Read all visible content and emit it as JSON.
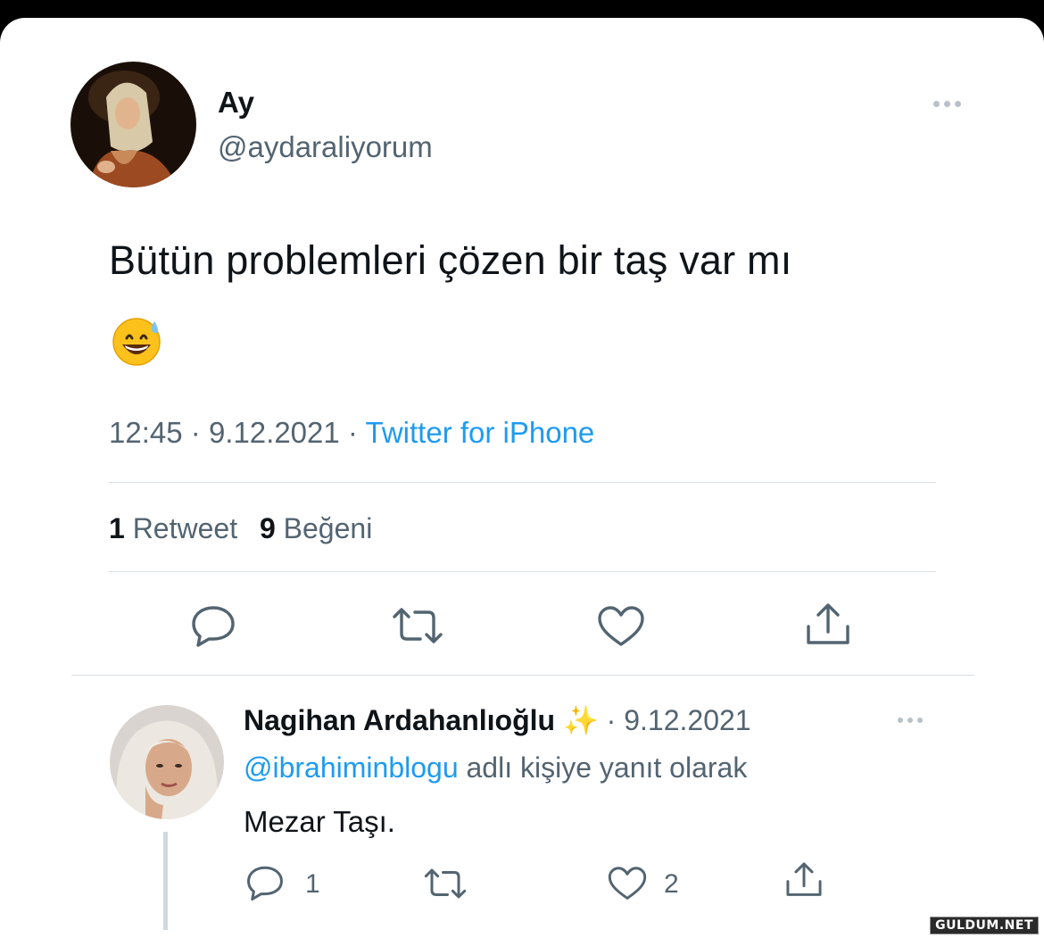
{
  "tweet": {
    "display_name": "Ay",
    "handle": "@aydaraliyorum",
    "text": "Bütün problemleri çözen bir taş var mı",
    "emoji": "grinning-face-with-sweat",
    "time": "12:45",
    "date": "9.12.2021",
    "separator": "·",
    "source": "Twitter for iPhone",
    "retweet_count": "1",
    "retweet_label": "Retweet",
    "like_count": "9",
    "like_label": "Beğeni"
  },
  "reply": {
    "display_name": "Nagihan Ardahanlıoğlu",
    "sparkle": "✨",
    "date": "· 9.12.2021",
    "reply_to_handle": "@ibrahiminblogu",
    "reply_to_text": "adlı kişiye yanıt olarak",
    "text": "Mezar Taşı.",
    "reply_count": "1",
    "like_count": "2"
  },
  "watermark": "GULDUM.NET",
  "colors": {
    "link": "#1d9bf0",
    "secondary_text": "#536471",
    "divider": "#d9dee2",
    "background": "#ffffff"
  },
  "icons": [
    "more-dots-icon",
    "reply-icon",
    "retweet-icon",
    "like-icon",
    "share-icon",
    "sparkles-icon"
  ]
}
